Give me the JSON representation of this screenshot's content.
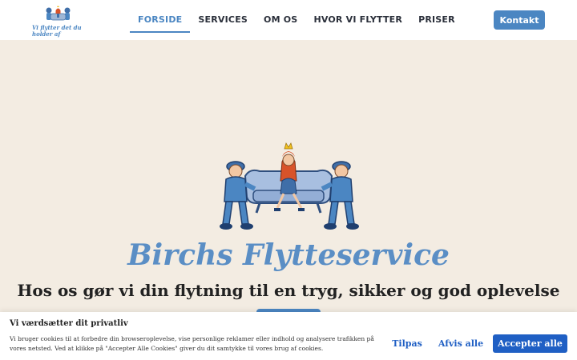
{
  "header": {
    "logo_tagline": "Vi flytter det du holder af",
    "nav": [
      {
        "label": "FORSIDE",
        "active": true
      },
      {
        "label": "SERVICES",
        "active": false
      },
      {
        "label": "OM OS",
        "active": false
      },
      {
        "label": "HVOR VI FLYTTER",
        "active": false
      },
      {
        "label": "PRISER",
        "active": false
      }
    ],
    "contact_label": "Kontakt"
  },
  "hero": {
    "title": "Birchs Flytteservice",
    "subtitle": "Hos os gør vi din flytning til en tryg, sikker og god oplevelse"
  },
  "cookie": {
    "title": "Vi værdsætter dit privatliv",
    "text": "Vi bruger cookies til at forbedre din browseroplevelse, vise personlige reklamer eller indhold og analysere trafikken på vores netsted. Ved at klikke på \"Accepter Alle Cookies\" giver du dit samtykke til vores brug af cookies.",
    "customize_label": "Tilpas",
    "reject_label": "Afvis alle",
    "accept_label": "Accepter alle"
  },
  "colors": {
    "accent": "#4b86c2",
    "cookie_accent": "#1f5fc4",
    "hero_bg": "#f3ece2"
  }
}
